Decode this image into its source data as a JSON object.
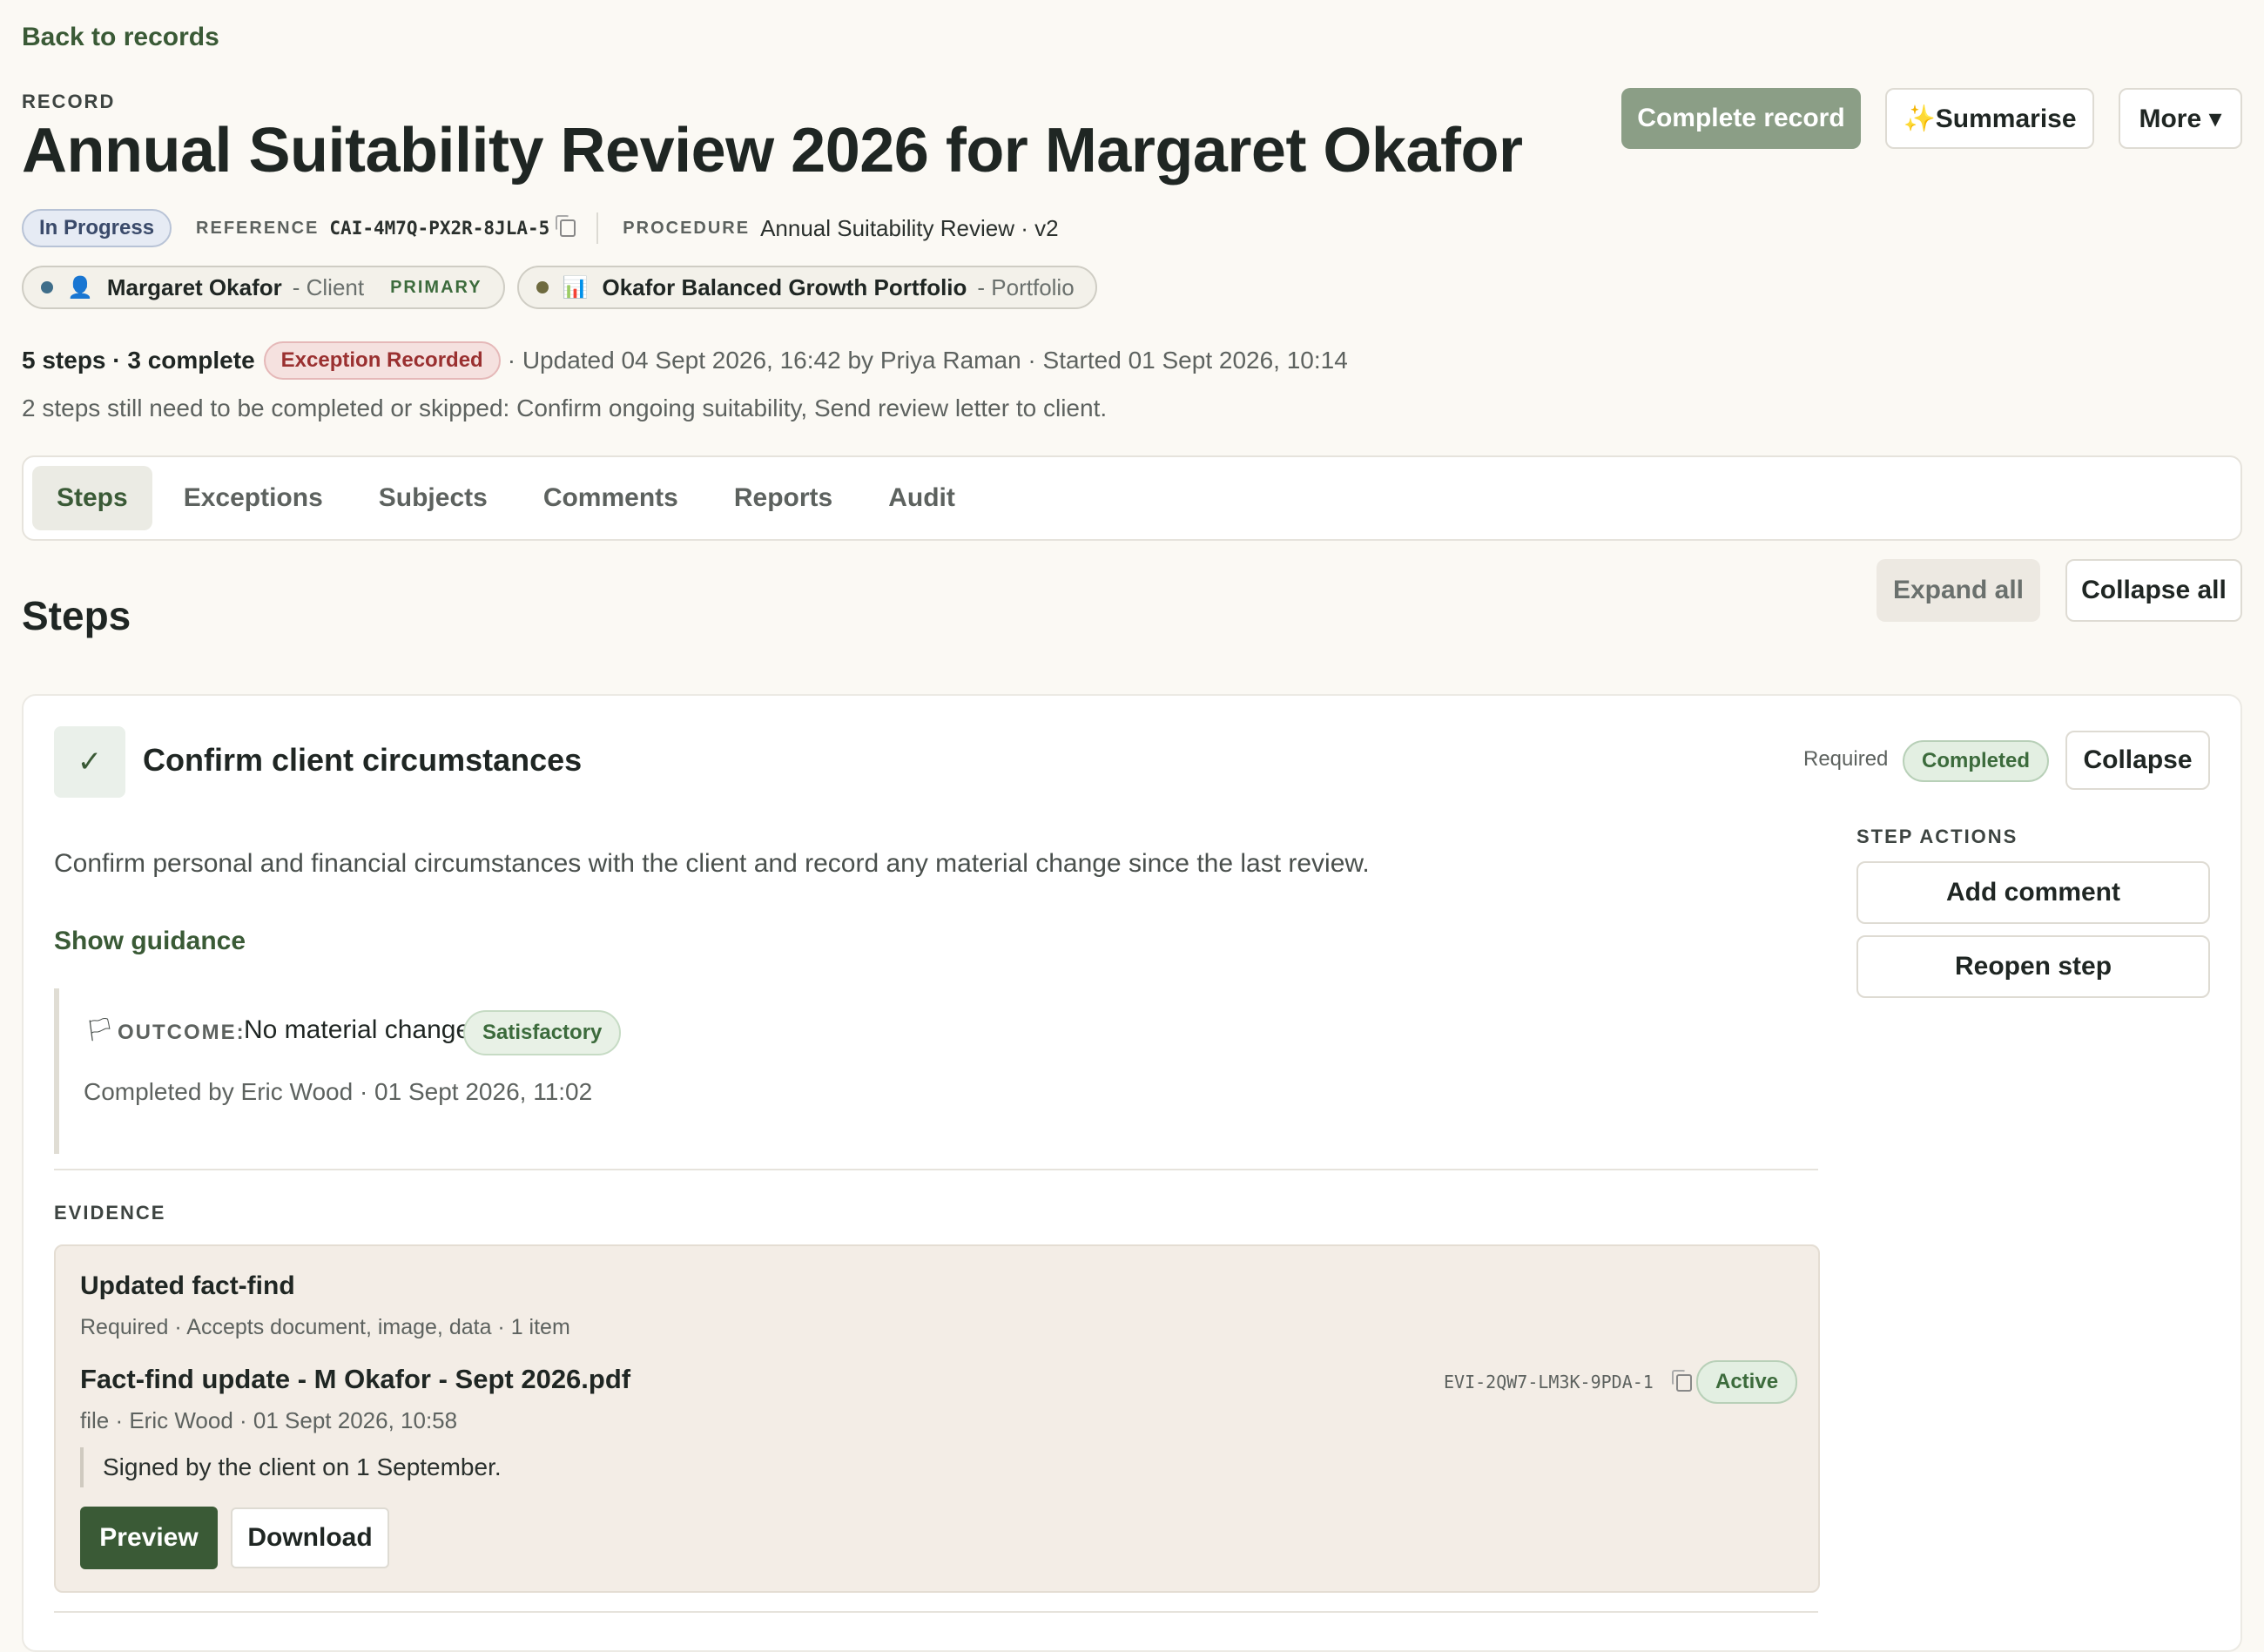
{
  "nav": {
    "back_label": "Back to records"
  },
  "header": {
    "eyebrow": "RECORD",
    "title": "Annual Suitability Review 2026 for Margaret Okafor",
    "complete_label": "Complete record",
    "summarise_label": "✨Summarise",
    "more_label": "More ▾"
  },
  "meta": {
    "status": "In Progress",
    "reference_label": "REFERENCE",
    "reference_value": "CAI-4M7Q-PX2R-8JLA-5",
    "procedure_label": "PROCEDURE",
    "procedure_value": "Annual Suitability Review · v2"
  },
  "subjects": [
    {
      "name": "Margaret Okafor",
      "role": "- Client",
      "badge": "PRIMARY",
      "icon": "person-icon",
      "dot_color": "#3f6e8a"
    },
    {
      "name": "Okafor Balanced Growth Portfolio",
      "role": "- Portfolio",
      "icon": "chart-icon",
      "dot_color": "#6e6a3f"
    }
  ],
  "summary": {
    "counts": "5 steps · 3 complete",
    "exception_badge": "Exception Recorded",
    "updated": "· Updated 04 Sept 2026, 16:42 by Priya Raman · Started 01 Sept 2026, 10:14",
    "pending": "2 steps still need to be completed or skipped: Confirm ongoing suitability, Send review letter to client."
  },
  "tabs": [
    {
      "label": "Steps",
      "active": true
    },
    {
      "label": "Exceptions"
    },
    {
      "label": "Subjects"
    },
    {
      "label": "Comments"
    },
    {
      "label": "Reports"
    },
    {
      "label": "Audit"
    }
  ],
  "steps_section": {
    "heading": "Steps",
    "expand_all": "Expand all",
    "collapse_all": "Collapse all"
  },
  "step": {
    "check_glyph": "✓",
    "title": "Confirm client circumstances",
    "required": "Required",
    "status": "Completed",
    "collapse_label": "Collapse",
    "description": "Confirm personal and financial circumstances with the client and record any material change since the last review.",
    "guidance_label": "Show guidance",
    "outcome_label": "OUTCOME:",
    "outcome_value": "No material change",
    "outcome_badge": "Satisfactory",
    "completed_by": "Completed by Eric Wood · 01 Sept 2026, 11:02",
    "actions_label": "STEP ACTIONS",
    "actions": [
      "Add comment",
      "Reopen step"
    ]
  },
  "evidence": {
    "label": "EVIDENCE",
    "title": "Updated fact-find",
    "meta": "Required · Accepts document, image, data · 1 item",
    "file_name": "Fact-find update - M Okafor - Sept 2026.pdf",
    "file_meta": "file · Eric Wood · 01 Sept 2026, 10:58",
    "evidence_id": "EVI-2QW7-LM3K-9PDA-1",
    "status": "Active",
    "note": "Signed by the client on 1 September.",
    "preview_label": "Preview",
    "download_label": "Download"
  }
}
